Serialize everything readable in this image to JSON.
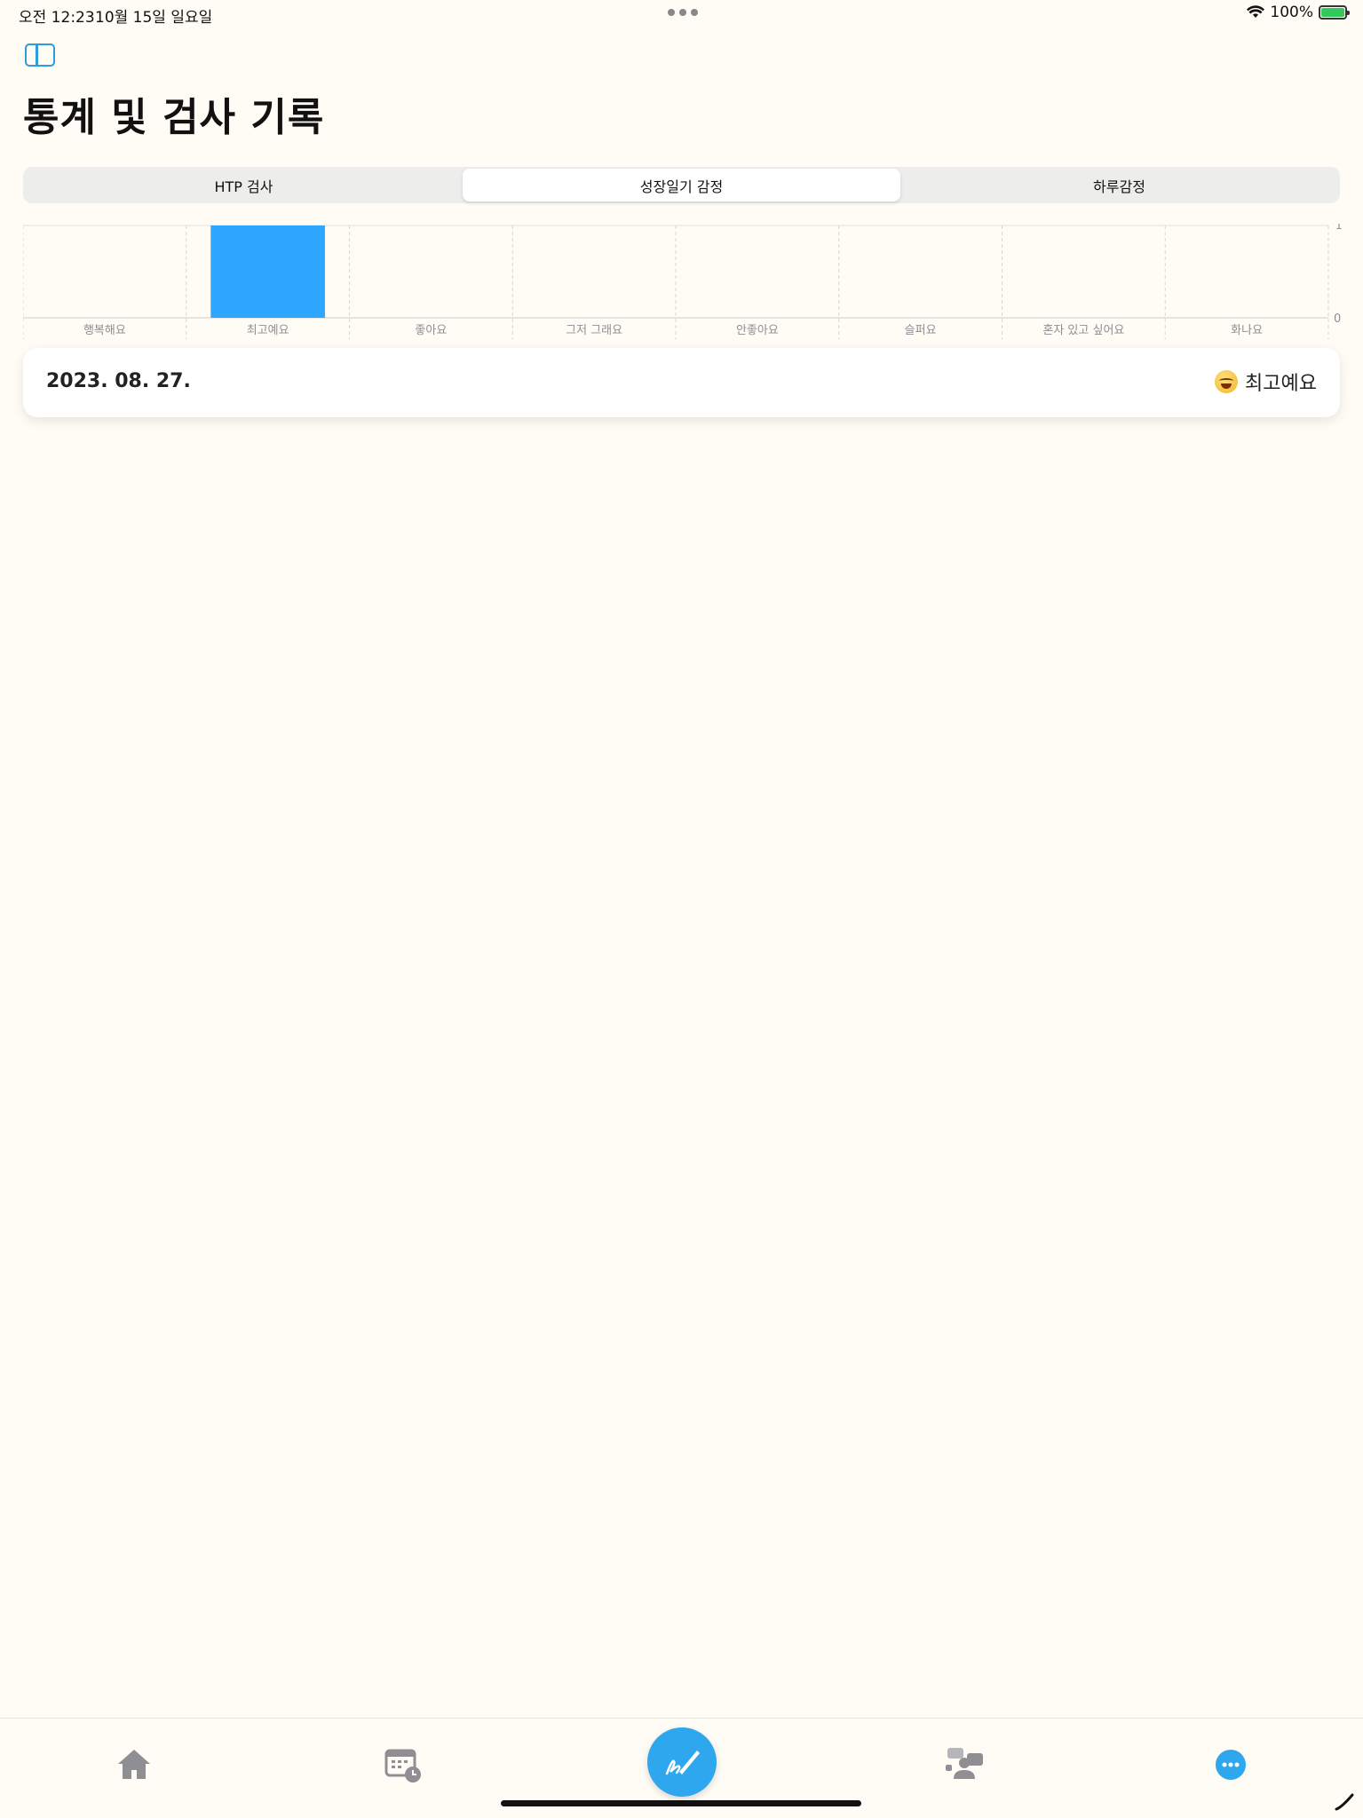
{
  "status_bar": {
    "time": "오전 12:23",
    "date": "10월 15일 일요일",
    "battery": "100%"
  },
  "header": {
    "title": "통계 및 검사 기록",
    "sidebar_icon": "sidebar-icon"
  },
  "segments": [
    {
      "label": "HTP 검사",
      "selected": false
    },
    {
      "label": "성장일기 감정",
      "selected": true
    },
    {
      "label": "하루감정",
      "selected": false
    }
  ],
  "chart_data": {
    "type": "bar",
    "categories": [
      "행복해요",
      "최고예요",
      "좋아요",
      "그저 그래요",
      "안좋아요",
      "슬퍼요",
      "혼자 있고 싶어요",
      "화나요"
    ],
    "values": [
      0,
      1,
      0,
      0,
      0,
      0,
      0,
      0
    ],
    "ylim": [
      0,
      1
    ],
    "y_ticks": [
      "1",
      "0"
    ],
    "bar_color": "#2fa7ff",
    "grid": true
  },
  "records": [
    {
      "date": "2023. 08. 27.",
      "mood_label": "최고예요",
      "mood_icon": "grinning-squinting-face-emoji"
    }
  ],
  "tab_bar": {
    "items": [
      "home-icon",
      "calendar-clock-icon",
      "pen-write-icon",
      "counsel-icon",
      "more-icon"
    ],
    "accent": "#2fa7ee",
    "inactive": "#8e8e93"
  }
}
